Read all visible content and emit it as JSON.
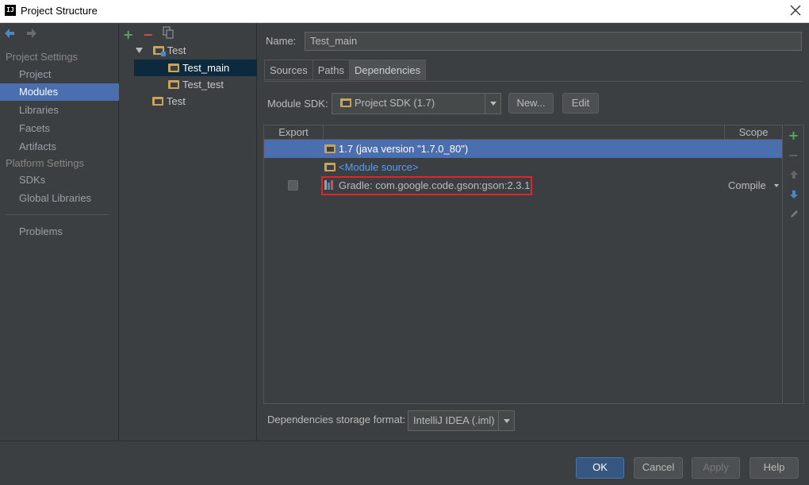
{
  "window": {
    "title": "Project Structure",
    "app_icon": "IJ"
  },
  "left_nav": {
    "section_project": "Project Settings",
    "project_items": [
      "Project",
      "Modules",
      "Libraries",
      "Facets",
      "Artifacts"
    ],
    "section_platform": "Platform Settings",
    "platform_items": [
      "SDKs",
      "Global Libraries"
    ],
    "problems": "Problems",
    "selected": "Modules"
  },
  "tree": {
    "root": "Test",
    "child_1": "Test_main",
    "child_2": "Test_test",
    "other": "Test",
    "add_glyph": "+",
    "remove_glyph": "−"
  },
  "module": {
    "name_label": "Name:",
    "name_value": "Test_main",
    "tabs": [
      "Sources",
      "Paths",
      "Dependencies"
    ],
    "active_tab": "Dependencies",
    "sdk_label": "Module SDK:",
    "sdk_value": "Project SDK (1.7)",
    "new_button": "New...",
    "edit_button": "Edit"
  },
  "dependencies": {
    "col_export": "Export",
    "col_scope": "Scope",
    "rows": [
      {
        "text": "1.7 (java version \"1.7.0_80\")"
      },
      {
        "text": "<Module source>"
      },
      {
        "text": "Gradle: com.google.code.gson:gson:2.3.1",
        "scope": "Compile",
        "export": false
      }
    ],
    "storage_label": "Dependencies storage format:",
    "storage_value": "IntelliJ IDEA (.iml)"
  },
  "footer": {
    "ok": "OK",
    "cancel": "Cancel",
    "apply": "Apply",
    "help": "Help"
  },
  "colors": {
    "selection": "#4b6eaf",
    "highlight_border": "#e0252a",
    "add_green": "#59a869",
    "remove_red": "#c75450",
    "link_blue": "#589df6"
  }
}
